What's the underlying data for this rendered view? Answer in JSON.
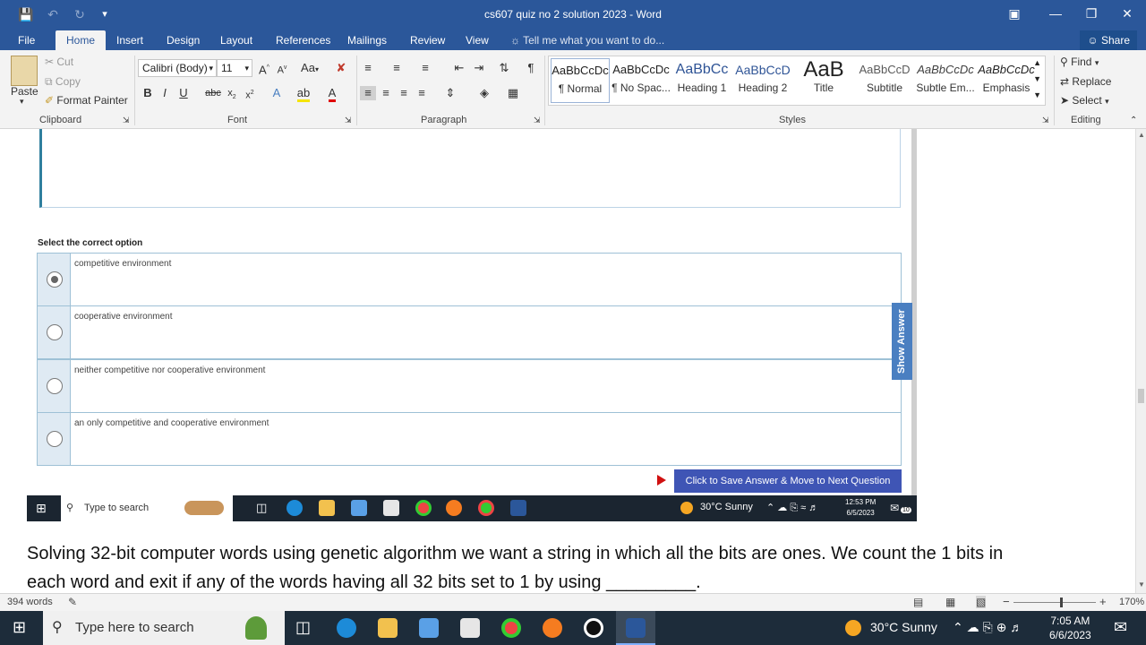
{
  "titlebar": {
    "title": "cs607 quiz no 2 solution 2023 - Word",
    "save_icon": "save-icon",
    "undo_icon": "undo-icon",
    "redo_icon": "redo-icon"
  },
  "tabs": {
    "items": [
      "File",
      "Home",
      "Insert",
      "Design",
      "Layout",
      "References",
      "Mailings",
      "Review",
      "View"
    ],
    "active": "Home",
    "tell_me": "Tell me what you want to do...",
    "share": "Share"
  },
  "ribbon": {
    "clipboard": {
      "label": "Clipboard",
      "paste": "Paste",
      "cut": "Cut",
      "copy": "Copy",
      "format_painter": "Format Painter"
    },
    "font": {
      "label": "Font",
      "family": "Calibri (Body)",
      "size": "11"
    },
    "paragraph": {
      "label": "Paragraph"
    },
    "styles": {
      "label": "Styles",
      "items": [
        {
          "sample": "AaBbCcDc",
          "name": "¶ Normal"
        },
        {
          "sample": "AaBbCcDc",
          "name": "¶ No Spac..."
        },
        {
          "sample": "AaBbCc",
          "name": "Heading 1"
        },
        {
          "sample": "AaBbCcD",
          "name": "Heading 2"
        },
        {
          "sample": "AaB",
          "name": "Title"
        },
        {
          "sample": "AaBbCcD",
          "name": "Subtitle"
        },
        {
          "sample": "AaBbCcDc",
          "name": "Subtle Em..."
        },
        {
          "sample": "AaBbCcDc",
          "name": "Emphasis"
        }
      ]
    },
    "editing": {
      "label": "Editing",
      "find": "Find",
      "replace": "Replace",
      "select": "Select"
    }
  },
  "quiz": {
    "prompt": "Select the correct option",
    "options": [
      {
        "text": "competitive environment",
        "selected": true
      },
      {
        "text": "cooperative environment",
        "selected": false
      },
      {
        "text": "neither competitive nor cooperative environment",
        "selected": false
      },
      {
        "text": "an only competitive and cooperative environment",
        "selected": false
      }
    ],
    "show_answer": "Show Answer",
    "next_button": "Click to Save Answer & Move to Next Question"
  },
  "inner_taskbar": {
    "search": "Type to search",
    "weather": "30°C  Sunny",
    "time": "12:53 PM",
    "date": "6/5/2023",
    "notif": "10"
  },
  "document": {
    "line1": "Solving 32-bit computer words using genetic algorithm we want a string in which all the bits are ones. We count the 1 bits in",
    "line2": "each word and exit if any of the words having all 32 bits set to 1 by using _________."
  },
  "statusbar": {
    "words": "394 words",
    "zoom": "170%"
  },
  "taskbar": {
    "search": "Type here to search",
    "weather": "30°C  Sunny",
    "time": "7:05 AM",
    "date": "6/6/2023"
  }
}
